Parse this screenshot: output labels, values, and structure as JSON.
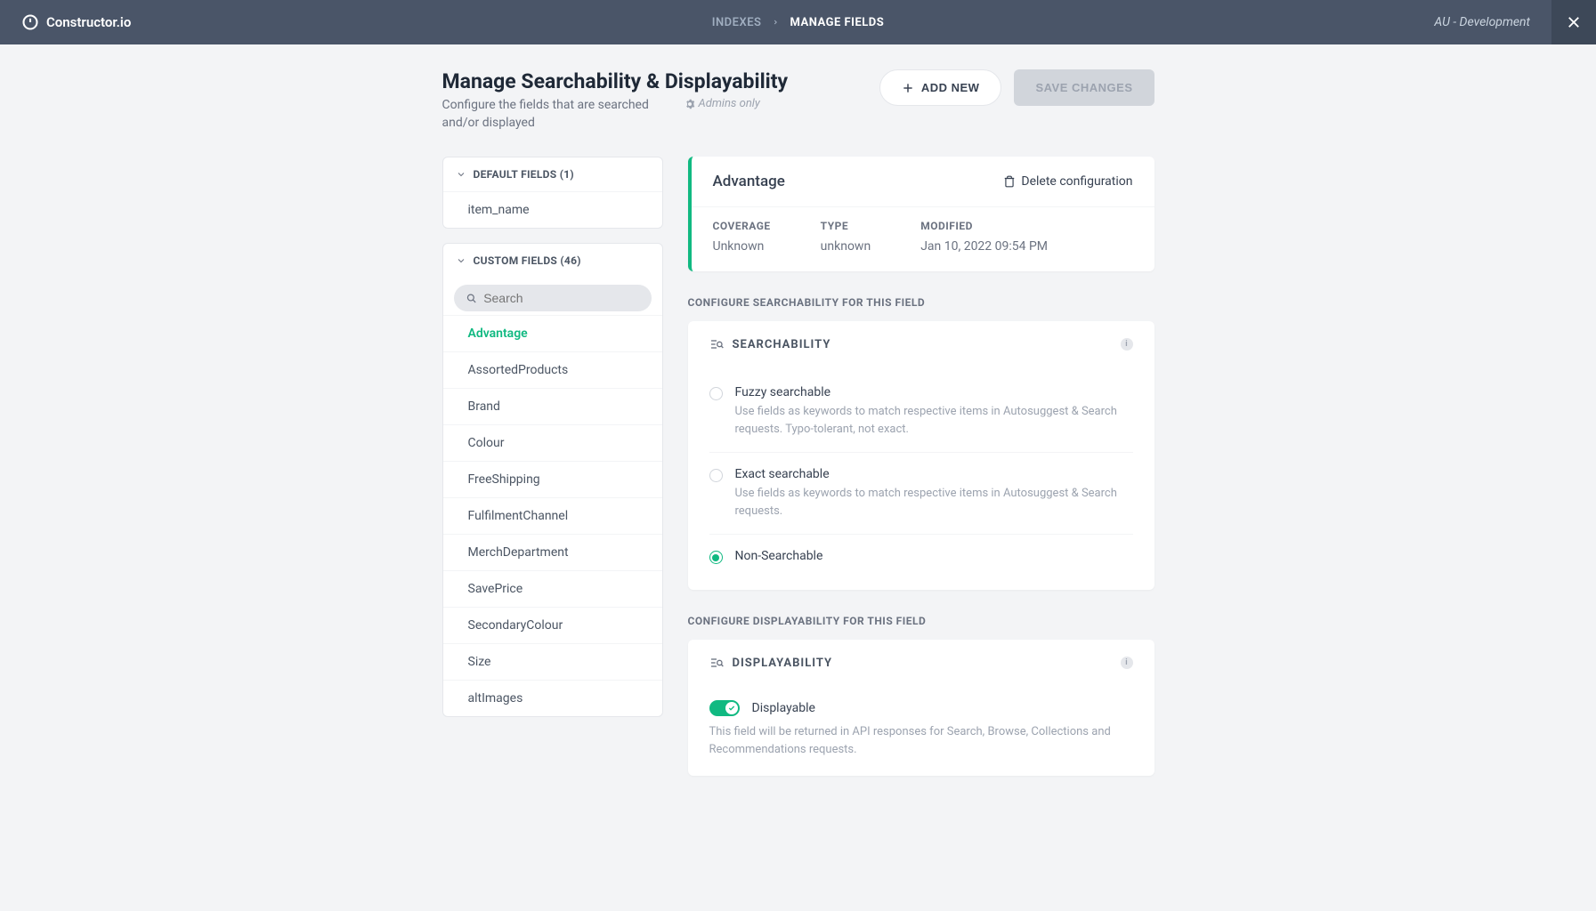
{
  "header": {
    "brand": "Constructor.io",
    "breadcrumb_parent": "INDEXES",
    "breadcrumb_current": "MANAGE FIELDS",
    "env": "AU - Development"
  },
  "page": {
    "title": "Manage Searchability & Displayability",
    "subtitle": "Configure the fields that are searched and/or displayed",
    "admins_only": "Admins only",
    "add_new": "ADD NEW",
    "save": "SAVE CHANGES"
  },
  "sidebar": {
    "default_header": "DEFAULT FIELDS (1)",
    "default_items": [
      "item_name"
    ],
    "custom_header": "CUSTOM FIELDS (46)",
    "search_placeholder": "Search",
    "custom_items": [
      "Advantage",
      "AssortedProducts",
      "Brand",
      "Colour",
      "FreeShipping",
      "FulfilmentChannel",
      "MerchDepartment",
      "SavePrice",
      "SecondaryColour",
      "Size",
      "altImages"
    ],
    "active_item": "Advantage"
  },
  "detail": {
    "title": "Advantage",
    "delete": "Delete configuration",
    "coverage_label": "COVERAGE",
    "coverage_value": "Unknown",
    "type_label": "TYPE",
    "type_value": "unknown",
    "modified_label": "MODIFIED",
    "modified_value": "Jan 10, 2022 09:54 PM"
  },
  "searchability": {
    "section_label": "CONFIGURE SEARCHABILITY FOR THIS FIELD",
    "head": "SEARCHABILITY",
    "options": [
      {
        "label": "Fuzzy searchable",
        "desc": "Use fields as keywords to match respective items in Autosuggest & Search requests. Typo-tolerant, not exact.",
        "checked": false
      },
      {
        "label": "Exact searchable",
        "desc": "Use fields as keywords to match respective items in Autosuggest & Search requests.",
        "checked": false
      },
      {
        "label": "Non-Searchable",
        "desc": "",
        "checked": true
      }
    ]
  },
  "displayability": {
    "section_label": "CONFIGURE DISPLAYABILITY FOR THIS FIELD",
    "head": "DISPLAYABILITY",
    "toggle_label": "Displayable",
    "toggle_desc": "This field will be returned in API responses for Search, Browse, Collections and Recommendations requests."
  }
}
